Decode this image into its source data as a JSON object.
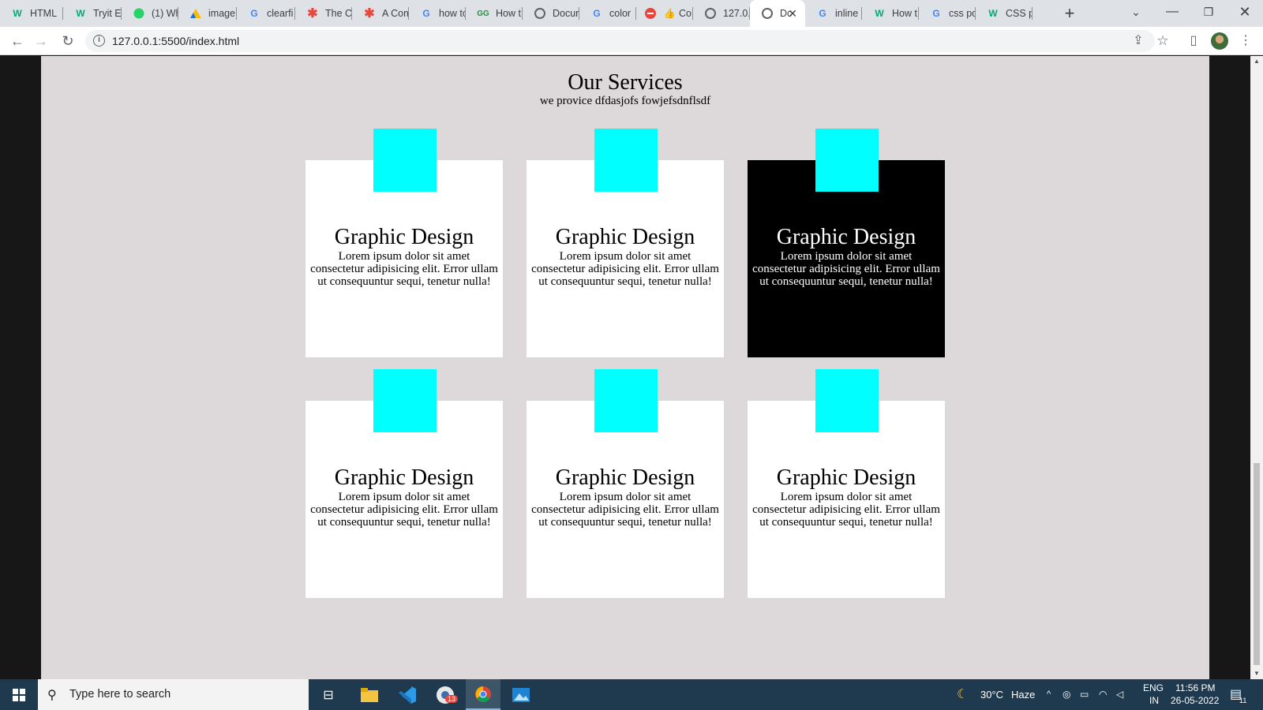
{
  "browser": {
    "tabs": [
      {
        "label": "HTML",
        "icon": "w3schools-icon"
      },
      {
        "label": "Tryit E",
        "icon": "w3schools-icon"
      },
      {
        "label": "(1) Wh",
        "icon": "whatsapp-icon"
      },
      {
        "label": "image",
        "icon": "google-drive-icon"
      },
      {
        "label": "clearfi",
        "icon": "google-icon"
      },
      {
        "label": "The Cl",
        "icon": "asterisk-icon"
      },
      {
        "label": "A Com",
        "icon": "asterisk-icon"
      },
      {
        "label": "how tc",
        "icon": "google-icon"
      },
      {
        "label": "How t",
        "icon": "geeks-icon"
      },
      {
        "label": "Docur",
        "icon": "globe-icon"
      },
      {
        "label": "color",
        "icon": "google-icon"
      },
      {
        "label": "Co",
        "icon": "thumbs-up-icon"
      },
      {
        "label": "127.0.",
        "icon": "globe-icon"
      },
      {
        "label": "Dc",
        "icon": "globe-icon",
        "active": true
      },
      {
        "label": "inline",
        "icon": "google-icon"
      },
      {
        "label": "How t",
        "icon": "w3schools-icon"
      },
      {
        "label": "css po",
        "icon": "google-icon"
      },
      {
        "label": "CSS p",
        "icon": "w3schools-icon"
      }
    ],
    "url": "127.0.0.1:5500/index.html"
  },
  "page": {
    "heading": "Our Services",
    "subheading": "we provice dfdasjofs fowjefsdnflsdf",
    "accent_color": "#00ffff",
    "cards": [
      {
        "title": "Graphic Design",
        "text": "Lorem ipsum dolor sit amet consectetur adipisicing elit. Error ullam ut consequuntur sequi, tenetur nulla!"
      },
      {
        "title": "Graphic Design",
        "text": "Lorem ipsum dolor sit amet consectetur adipisicing elit. Error ullam ut consequuntur sequi, tenetur nulla!"
      },
      {
        "title": "Graphic Design",
        "text": "Lorem ipsum dolor sit amet consectetur adipisicing elit. Error ullam ut consequuntur sequi, tenetur nulla!",
        "highlighted": true
      },
      {
        "title": "Graphic Design",
        "text": "Lorem ipsum dolor sit amet consectetur adipisicing elit. Error ullam ut consequuntur sequi, tenetur nulla!"
      },
      {
        "title": "Graphic Design",
        "text": "Lorem ipsum dolor sit amet consectetur adipisicing elit. Error ullam ut consequuntur sequi, tenetur nulla!"
      },
      {
        "title": "Graphic Design",
        "text": "Lorem ipsum dolor sit amet consectetur adipisicing elit. Error ullam ut consequuntur sequi, tenetur nulla!"
      }
    ]
  },
  "taskbar": {
    "search_placeholder": "Type here to search",
    "chrome_badge": "13",
    "weather_temp": "30°C",
    "weather_text": "Haze",
    "language": "ENG",
    "region": "IN",
    "time": "11:56 PM",
    "date": "26-05-2022",
    "notifications": "11"
  }
}
